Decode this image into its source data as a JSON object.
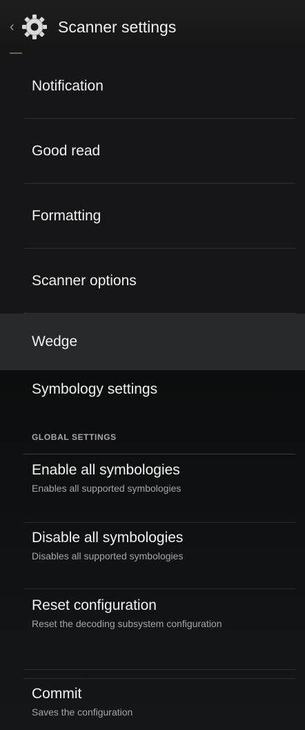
{
  "action_bar": {
    "title": "Scanner settings",
    "up_icon": "chevron-left-icon",
    "app_icon": "gear-icon"
  },
  "categories": [
    {
      "label": "Notification"
    },
    {
      "label": "Good read"
    },
    {
      "label": "Formatting"
    },
    {
      "label": "Scanner options"
    },
    {
      "label": "Wedge"
    }
  ],
  "details": {
    "title": "Symbology settings",
    "group_header": "GLOBAL SETTINGS",
    "items": [
      {
        "title": "Enable all symbologies",
        "summary": "Enables all supported symbologies"
      },
      {
        "title": "Disable all symbologies",
        "summary": "Disables all supported symbologies"
      },
      {
        "title": "Reset configuration",
        "summary": "Reset the decoding subsystem configuration"
      },
      {
        "title": "Commit",
        "summary": "Saves the configuration"
      }
    ]
  },
  "colors": {
    "action_bar": "#1a1a1b",
    "panel_top": "#161618",
    "selected": "#26282b",
    "panel_bottom": "#0f1012",
    "text_primary": "#f1f1f1",
    "text_secondary": "#a6a6a6"
  }
}
